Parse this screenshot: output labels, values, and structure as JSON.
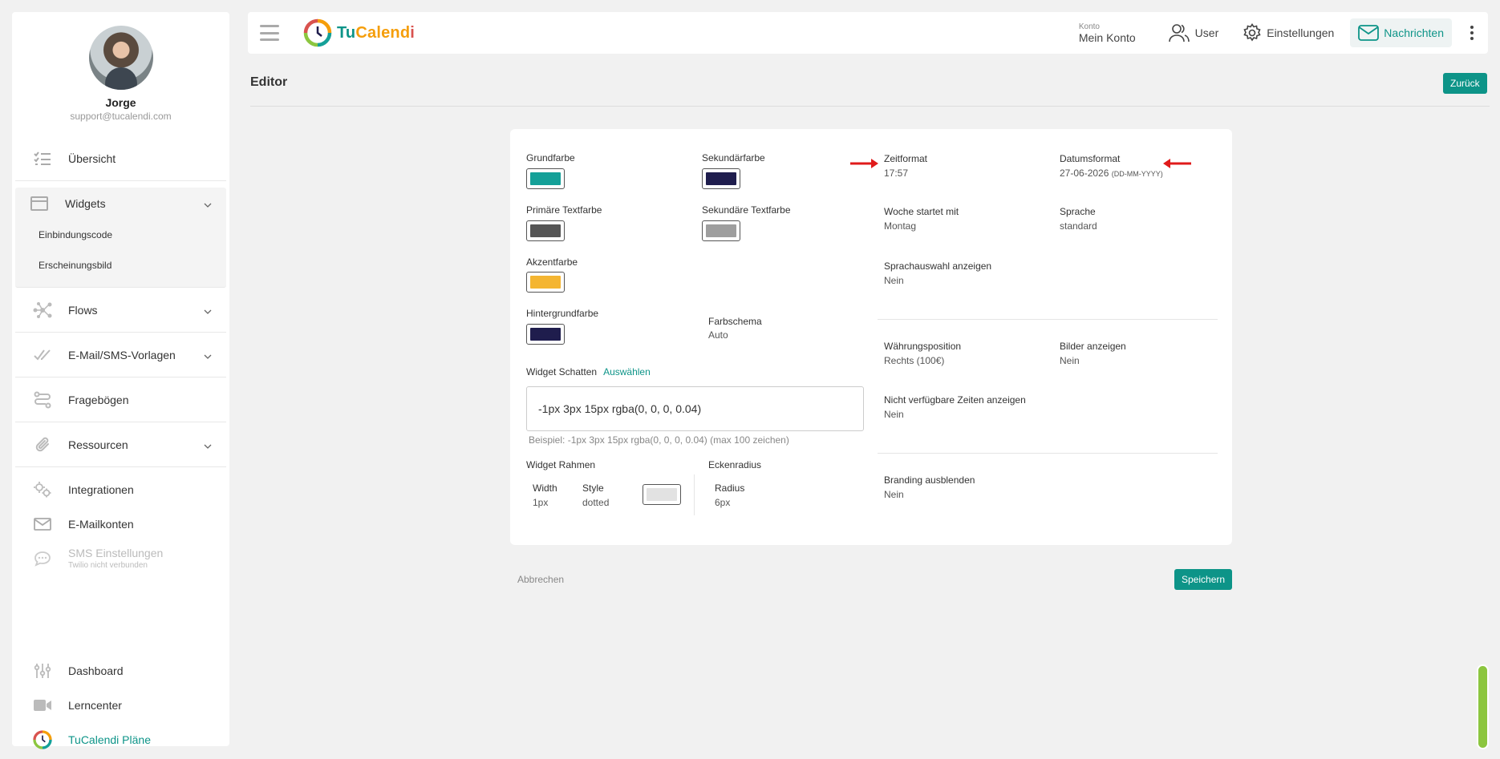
{
  "profile": {
    "name": "Jorge",
    "email": "support@tucalendi.com"
  },
  "nav": {
    "uebersicht": "Übersicht",
    "widgets": "Widgets",
    "einbindungscode": "Einbindungscode",
    "erscheinungsbild": "Erscheinungsbild",
    "flows": "Flows",
    "email_sms": "E-Mail/SMS-Vorlagen",
    "frageboegen": "Fragebögen",
    "ressourcen": "Ressourcen",
    "integrationen": "Integrationen",
    "emailkonten": "E-Mailkonten",
    "sms_einstellungen": "SMS Einstellungen",
    "sms_sub": "Twilio nicht verbunden",
    "dashboard": "Dashboard",
    "lerncenter": "Lerncenter",
    "plaene": "TuCalendi Pläne"
  },
  "topbar": {
    "logo_tu": "Tu",
    "logo_cal": "Calend",
    "logo_i": "i",
    "konto_small": "Konto",
    "konto_big": "Mein Konto",
    "user": "User",
    "einstellungen": "Einstellungen",
    "nachrichten": "Nachrichten"
  },
  "page": {
    "title": "Editor",
    "back": "Zurück",
    "cancel": "Abbrechen",
    "save": "Speichern"
  },
  "editor": {
    "grundfarbe": "Grundfarbe",
    "sekundaerfarbe": "Sekundärfarbe",
    "primaere_textfarbe": "Primäre Textfarbe",
    "sekundaere_textfarbe": "Sekundäre Textfarbe",
    "akzentfarbe": "Akzentfarbe",
    "hintergrundfarbe": "Hintergrundfarbe",
    "farbschema": "Farbschema",
    "farbschema_val": "Auto",
    "widget_schatten": "Widget Schatten",
    "auswaehlen": "Auswählen",
    "schatten_val": "-1px 3px 15px rgba(0, 0, 0, 0.04)",
    "schatten_hint": "Beispiel: -1px 3px 15px rgba(0, 0, 0, 0.04) (max 100 zeichen)",
    "widget_rahmen": "Widget Rahmen",
    "width": "Width",
    "width_val": "1px",
    "style": "Style",
    "style_val": "dotted",
    "eckenradius": "Eckenradius",
    "radius": "Radius",
    "radius_val": "6px",
    "zeitformat": "Zeitformat",
    "zeitformat_val": "17:57",
    "datumsformat": "Datumsformat",
    "datumsformat_val": "27-06-2026",
    "datumsformat_fmt": "(DD-MM-YYYY)",
    "woche": "Woche startet mit",
    "woche_val": "Montag",
    "sprache": "Sprache",
    "sprache_val": "standard",
    "sprachauswahl": "Sprachauswahl anzeigen",
    "sprachauswahl_val": "Nein",
    "waehrungsposition": "Währungsposition",
    "waehrungsposition_val": "Rechts (100€)",
    "bilder": "Bilder anzeigen",
    "bilder_val": "Nein",
    "nicht_verfuegbar": "Nicht verfügbare Zeiten anzeigen",
    "nicht_verfuegbar_val": "Nein",
    "branding": "Branding ausblenden",
    "branding_val": "Nein"
  },
  "colors": {
    "grundfarbe": "#14a098",
    "sekundaerfarbe": "#1f1d4d",
    "primaere_textfarbe": "#555555",
    "sekundaere_textfarbe": "#9e9e9e",
    "akzentfarbe": "#f4b531",
    "hintergrundfarbe": "#1f1d4d",
    "rahmen": "#e2e2e2",
    "accent": "#0d9488"
  }
}
